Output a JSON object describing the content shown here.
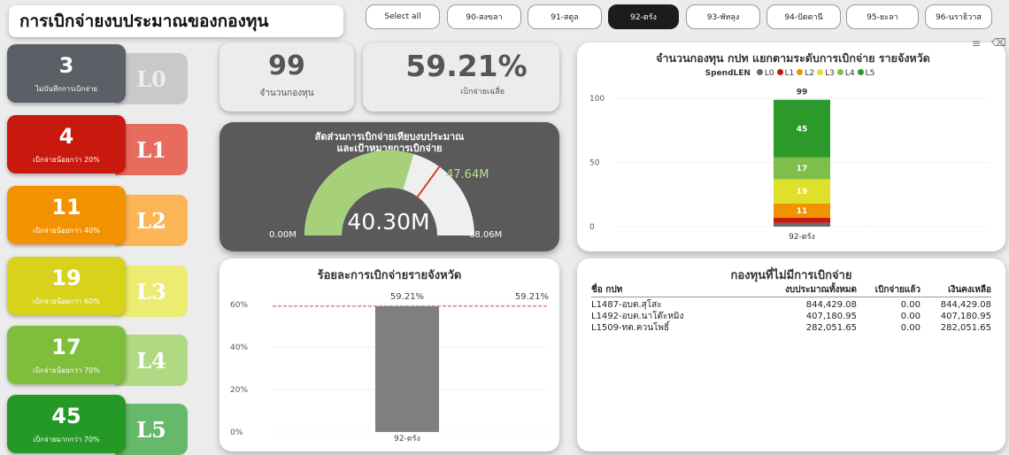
{
  "title": "การเบิกจ่ายงบประมาณของกองทุน",
  "filters": [
    {
      "label": "Select all",
      "selected": false
    },
    {
      "label": "90-สงขลา",
      "selected": false
    },
    {
      "label": "91-สตูล",
      "selected": false
    },
    {
      "label": "92-ตรัง",
      "selected": true
    },
    {
      "label": "93-พัทลุง",
      "selected": false
    },
    {
      "label": "94-ปัตตานี",
      "selected": false
    },
    {
      "label": "95-ยะลา",
      "selected": false
    },
    {
      "label": "96-นราธิวาส",
      "selected": false
    }
  ],
  "levels": [
    {
      "count": "3",
      "caption": "ไม่บันทึกการเบิกจ่าย",
      "tag": "L0",
      "color_main": "#5b5f66",
      "color_tag": "#c9c9c9",
      "tag_text_color": "#ededed"
    },
    {
      "count": "4",
      "caption": "เบิกจ่ายน้อยกว่า 20%",
      "tag": "L1",
      "color_main": "#c9180d",
      "color_tag": "#e86c5d",
      "tag_text_color": "#ffffff"
    },
    {
      "count": "11",
      "caption": "เบิกจ่ายน้อยกว่า 40%",
      "tag": "L2",
      "color_main": "#f39200",
      "color_tag": "#fbb557",
      "tag_text_color": "#ffffff"
    },
    {
      "count": "19",
      "caption": "เบิกจ่ายน้อยกว่า 60%",
      "tag": "L3",
      "color_main": "#d8d31a",
      "color_tag": "#ecec70",
      "tag_text_color": "#ffffff"
    },
    {
      "count": "17",
      "caption": "เบิกจ่ายน้อยกว่า 70%",
      "tag": "L4",
      "color_main": "#7ebe3c",
      "color_tag": "#b1d882",
      "tag_text_color": "#ffffff"
    },
    {
      "count": "45",
      "caption": "เบิกจ่ายมากกว่า 70%",
      "tag": "L5",
      "color_main": "#249925",
      "color_tag": "#66b86a",
      "tag_text_color": "#ffffff"
    }
  ],
  "kpi": {
    "funds_value": "99",
    "funds_caption": "จำนวนกองทุน",
    "avg_value": "59.21%",
    "avg_caption": "เบิกจ่ายเฉลี่ย"
  },
  "gauge": {
    "title_line1": "สัดส่วนการเบิกจ่ายเทียบงบประมาณ",
    "title_line2": "และเป้าหมายการเบิกจ่าย",
    "value": 40.3,
    "target": 47.64,
    "min": 0,
    "max": 68.06,
    "value_label": "40.30M",
    "target_label": "47.64M",
    "min_label": "0.00M",
    "max_label": "68.06M",
    "fill_color": "#a6d17a",
    "track_color": "#efefef",
    "target_color": "#d33f2c",
    "target_label_color": "#b9e08f"
  },
  "pct_chart": {
    "title": "ร้อยละการเบิกจ่ายรายจังหวัด",
    "avg_label": "59.21%",
    "chart_data": {
      "type": "bar",
      "categories": [
        "92-ตรัง"
      ],
      "values": [
        59.21
      ],
      "data_labels": [
        "59.21%"
      ],
      "reference_line": {
        "value": 59.21,
        "label": "59.21%",
        "color": "#e87e98"
      },
      "ylim": [
        0,
        65
      ],
      "yticks": [
        0,
        20,
        40,
        60
      ],
      "ytick_labels": [
        "0%",
        "20%",
        "40%",
        "60%"
      ],
      "bar_color": "#7f7f7f"
    }
  },
  "stack_chart": {
    "title": "จำนวนกองทุน กปท แยกตามระดับการเบิกจ่าย รายจังหวัด",
    "legend_title": "SpendLEN",
    "chart_data": {
      "type": "bar",
      "stacked": true,
      "categories": [
        "92-ตรัง"
      ],
      "series": [
        {
          "name": "L0",
          "values": [
            3
          ],
          "color": "#6a6a6a"
        },
        {
          "name": "L1",
          "values": [
            4
          ],
          "color": "#c9180d"
        },
        {
          "name": "L2",
          "values": [
            11
          ],
          "color": "#f39200"
        },
        {
          "name": "L3",
          "values": [
            19
          ],
          "color": "#dfe02a"
        },
        {
          "name": "L4",
          "values": [
            17
          ],
          "color": "#7ebe4a"
        },
        {
          "name": "L5",
          "values": [
            45
          ],
          "color": "#2b9a2b"
        }
      ],
      "show_labels_for": [
        "L2",
        "L3",
        "L4",
        "L5"
      ],
      "total_label": "99",
      "ylim": [
        0,
        105
      ],
      "yticks": [
        0,
        50,
        100
      ]
    }
  },
  "table": {
    "title": "กองทุนที่ไม่มีการเบิกจ่าย",
    "headers": [
      "ชื่อ กปท",
      "งบประมาณทั้งหมด",
      "เบิกจ่ายแล้ว",
      "เงินคงเหลือ"
    ],
    "rows": [
      [
        "L1487-อบต.สุโสะ",
        "844,429.08",
        "0.00",
        "844,429.08"
      ],
      [
        "L1492-อบต.นาโต๊ะหมิง",
        "407,180.95",
        "0.00",
        "407,180.95"
      ],
      [
        "L1509-ทต.ควนโพธิ์",
        "282,051.65",
        "0.00",
        "282,051.65"
      ]
    ]
  }
}
